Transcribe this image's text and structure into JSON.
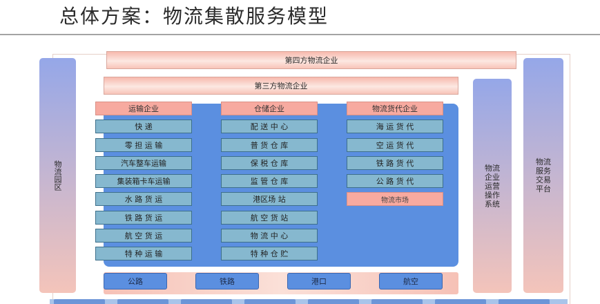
{
  "title": "总体方案：物流集散服务模型",
  "left_pillar": "物流园区",
  "right_pillar_1": "物流企业运营操作系统",
  "right_pillar_2": "物流服务交易平台",
  "top_bar_1": "第四方物流企业",
  "top_bar_2": "第三方物流企业",
  "columns": [
    {
      "header": "运输企业",
      "items": [
        "快 递",
        "零 担 运 输",
        "汽车整车运输",
        "集装箱卡车运输",
        "水 路 货 运",
        "铁 路 货 运",
        "航 空 货 运",
        "特 种 运 输"
      ]
    },
    {
      "header": "仓储企业",
      "items": [
        "配 送 中 心",
        "普 货 仓 库",
        "保 税 仓 库",
        "监 管 仓 库",
        "港区场 站",
        "航 空 货 站",
        "物 流 中 心",
        "特 种 仓 贮"
      ]
    },
    {
      "header": "物流货代企业",
      "items": [
        "海 运 货 代",
        "空 运 货 代",
        "铁 路 货 代",
        "公 路 货 代"
      ],
      "extra": "物流市场"
    }
  ],
  "transport_modes": [
    "公路",
    "铁路",
    "港口",
    "航空"
  ],
  "colors": {
    "main_blue": "#5b8fe0",
    "item_blue": "#86b8cf",
    "header_pink": "#f7aaa0",
    "pillar_top": "#95a7e8",
    "pillar_bottom": "#f4c4ba"
  }
}
